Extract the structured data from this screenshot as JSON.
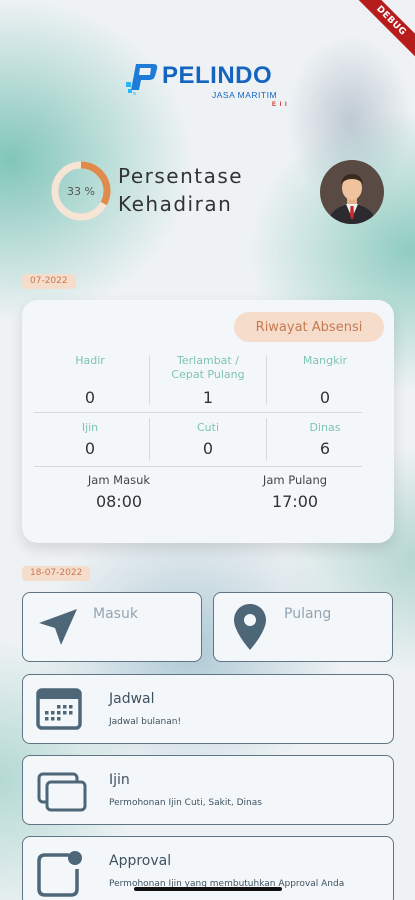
{
  "debug_banner": "DEBUG",
  "logo": {
    "name": "PELINDO",
    "subtitle": "JASA MARITIM",
    "subline": "E I I"
  },
  "attendance": {
    "percent": 33,
    "percent_label": "33 %",
    "title_line1": "Persentase",
    "title_line2": "Kehadiran"
  },
  "summary": {
    "period": "07-2022",
    "history_button": "Riwayat Absensi",
    "stats": [
      {
        "label": "Hadir",
        "value": "0"
      },
      {
        "label": "Terlambat / Cepat Pulang",
        "value": "1"
      },
      {
        "label": "Mangkir",
        "value": "0"
      },
      {
        "label": "Ijin",
        "value": "0"
      },
      {
        "label": "Cuti",
        "value": "0"
      },
      {
        "label": "Dinas",
        "value": "6"
      }
    ],
    "jam_masuk_label": "Jam Masuk",
    "jam_masuk": "08:00",
    "jam_pulang_label": "Jam Pulang",
    "jam_pulang": "17:00"
  },
  "today": {
    "date": "18-07-2022",
    "masuk_label": "Masuk",
    "pulang_label": "Pulang"
  },
  "menu": [
    {
      "title": "Jadwal",
      "subtitle": "Jadwal bulanan!"
    },
    {
      "title": "Ijin",
      "subtitle": "Permohonan Ijin Cuti, Sakit, Dinas"
    },
    {
      "title": "Approval",
      "subtitle": "Permohonan Ijin yang membutuhkan Approval Anda"
    }
  ],
  "colors": {
    "accent_orange": "#e08a4c",
    "chip_bg": "#f5dccb",
    "teal_label": "#7ec4b4",
    "icon_slate": "#4d6678",
    "logo_blue": "#1565c0"
  }
}
